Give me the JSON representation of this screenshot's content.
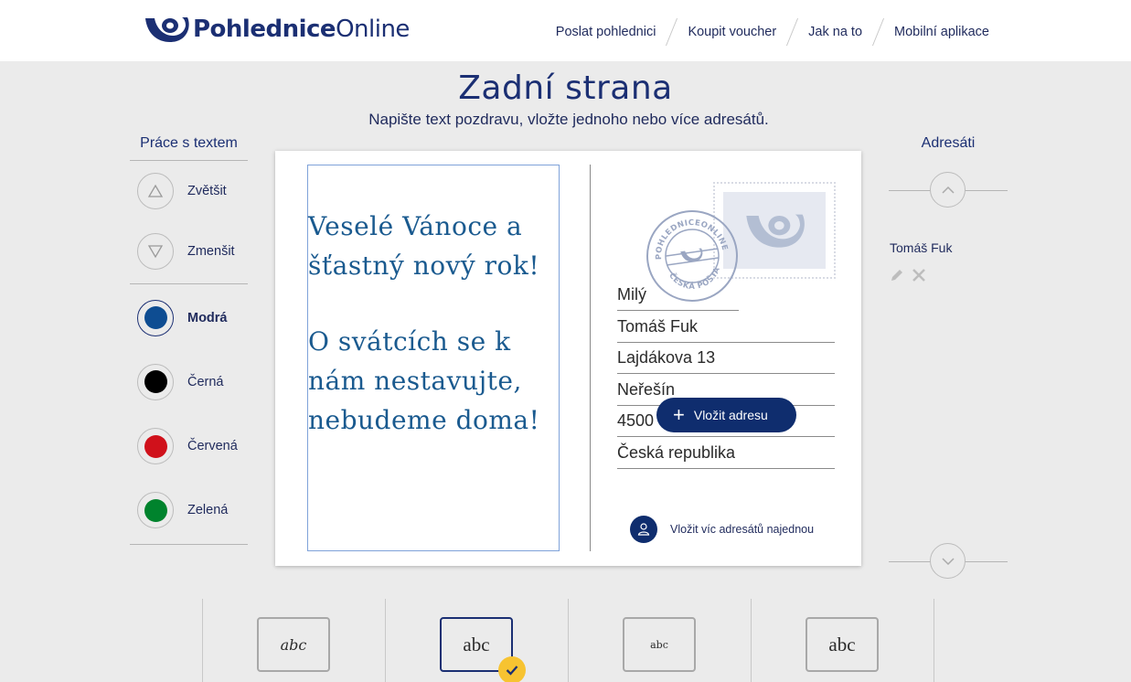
{
  "header": {
    "logo_bold": "Pohlednice",
    "logo_light": "Online",
    "nav": [
      "Poslat pohlednici",
      "Koupit voucher",
      "Jak na to",
      "Mobilní aplikace"
    ]
  },
  "page": {
    "title": "Zadní strana",
    "subtitle": "Napište text pozdravu, vložte jednoho nebo více adresátů."
  },
  "text_tools": {
    "title": "Práce s textem",
    "size": [
      {
        "label": "Zvětšit",
        "icon": "triangle-up-icon"
      },
      {
        "label": "Zmenšit",
        "icon": "triangle-down-icon"
      }
    ],
    "colors": [
      {
        "label": "Modrá",
        "color": "#0e4d92",
        "selected": true
      },
      {
        "label": "Černá",
        "color": "#000000",
        "selected": false
      },
      {
        "label": "Červená",
        "color": "#d0111b",
        "selected": false
      },
      {
        "label": "Zelená",
        "color": "#00832d",
        "selected": false
      }
    ]
  },
  "card": {
    "message_line1": "Veselé Vánoce a šťastný nový rok!",
    "message_line2": "O svátcích se k nám nestavujte, nebudeme doma!",
    "address": {
      "greeting": "Milý",
      "name": "Tomáš Fuk",
      "street": "Lajdákova 13",
      "city": "Neřešín",
      "zip": "4500",
      "country": "Česká republika"
    },
    "insert_address_button": "Vložit adresu",
    "multi_recipients": "Vložit víc adresátů najednou",
    "postmark_top": "POHLEDNICEONLINE",
    "postmark_bottom": "ČESKÁ POŠTA"
  },
  "recipients": {
    "title": "Adresáti",
    "items": [
      "Tomáš Fuk"
    ]
  },
  "fonts": [
    {
      "sample": "abc",
      "style": "script",
      "selected": false
    },
    {
      "sample": "abc",
      "style": "serif",
      "selected": true
    },
    {
      "sample": "abc",
      "style": "small",
      "selected": false
    },
    {
      "sample": "abc",
      "style": "serif-plain",
      "selected": false
    }
  ],
  "colors": {
    "brand": "#1b2f73",
    "button": "#0f2d6e",
    "check": "#f7c331",
    "message_text": "#1a5a8f"
  }
}
